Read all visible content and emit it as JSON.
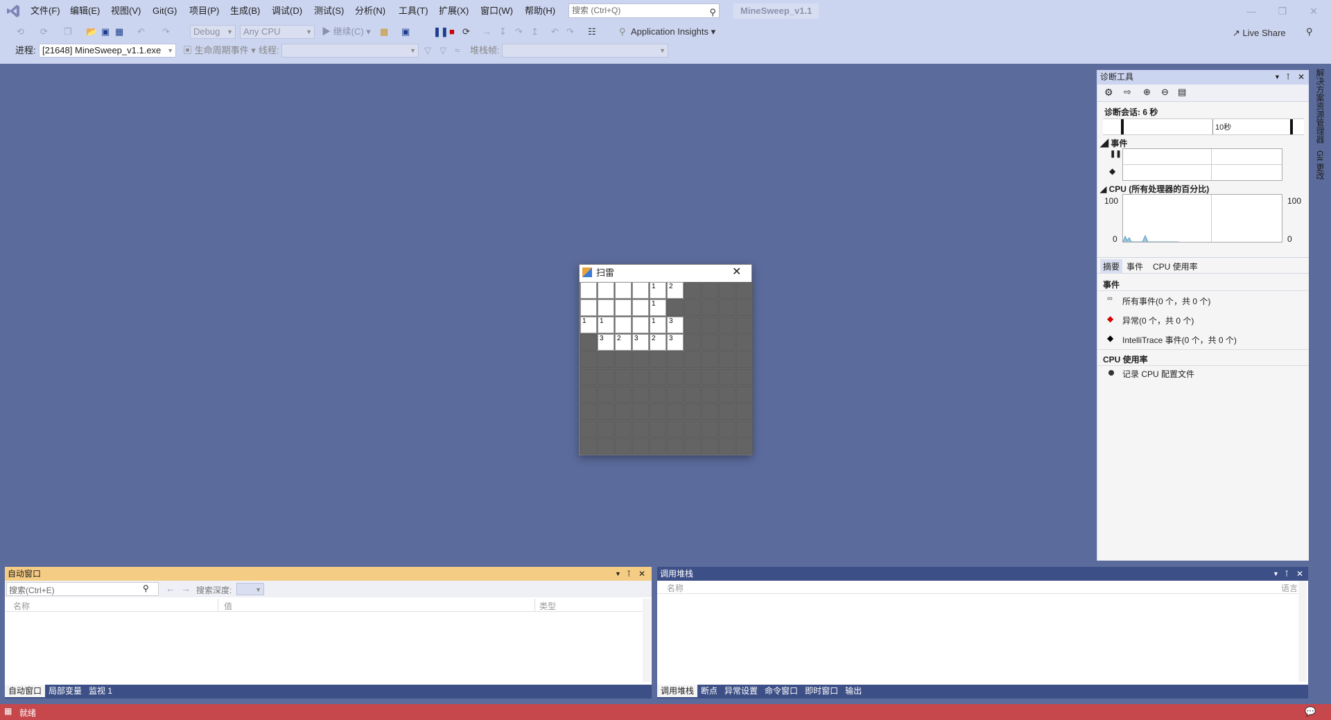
{
  "menu": [
    "文件(F)",
    "编辑(E)",
    "视图(V)",
    "Git(G)",
    "项目(P)",
    "生成(B)",
    "调试(D)",
    "测试(S)",
    "分析(N)",
    "工具(T)",
    "扩展(X)",
    "窗口(W)",
    "帮助(H)"
  ],
  "search": {
    "placeholder": "搜索 (Ctrl+Q)"
  },
  "solution_title": "MineSweep_v1.1",
  "toolbar": {
    "config": "Debug",
    "platform": "Any CPU",
    "continue_label": "继续(C)",
    "app_insights": "Application Insights",
    "live_share": "Live Share"
  },
  "debug_bar": {
    "process_label": "进程:",
    "process_value": "[21648] MineSweep_v1.1.exe",
    "lifecycle_label": "生命周期事件",
    "thread_label": "线程:",
    "stackframe_label": "堆栈帧:"
  },
  "minesweeper": {
    "title": "扫雷",
    "grid": [
      [
        "o",
        "o",
        "o",
        "o",
        "1",
        "2",
        "c",
        "c",
        "c",
        "c"
      ],
      [
        "o",
        "o",
        "o",
        "o",
        "1",
        "c",
        "c",
        "c",
        "c",
        "c"
      ],
      [
        "1",
        "1",
        "o",
        "o",
        "1",
        "3",
        "c",
        "c",
        "c",
        "c"
      ],
      [
        "c",
        "3",
        "2",
        "3",
        "2",
        "3",
        "c",
        "c",
        "c",
        "c"
      ],
      [
        "c",
        "c",
        "c",
        "c",
        "c",
        "c",
        "c",
        "c",
        "c",
        "c"
      ],
      [
        "c",
        "c",
        "c",
        "c",
        "c",
        "c",
        "c",
        "c",
        "c",
        "c"
      ],
      [
        "c",
        "c",
        "c",
        "c",
        "c",
        "c",
        "c",
        "c",
        "c",
        "c"
      ],
      [
        "c",
        "c",
        "c",
        "c",
        "c",
        "c",
        "c",
        "c",
        "c",
        "c"
      ],
      [
        "c",
        "c",
        "c",
        "c",
        "c",
        "c",
        "c",
        "c",
        "c",
        "c"
      ],
      [
        "c",
        "c",
        "c",
        "c",
        "c",
        "c",
        "c",
        "c",
        "c",
        "c"
      ]
    ]
  },
  "diag": {
    "title": "诊断工具",
    "session": "诊断会话: 6 秒",
    "timeline_label": "10秒",
    "events_section": "事件",
    "cpu_section": "CPU (所有处理器的百分比)",
    "cpu_max": "100",
    "cpu_min": "0",
    "tabs": [
      "摘要",
      "事件",
      "CPU 使用率"
    ],
    "events_heading": "事件",
    "event_items": [
      "所有事件(0 个，共 0 个)",
      "异常(0 个，共 0 个)",
      "IntelliTrace 事件(0 个，共 0 个)"
    ],
    "cpu_heading": "CPU 使用率",
    "cpu_item": "记录 CPU 配置文件"
  },
  "side_tabs": [
    "解决方案资源管理器",
    "Git 更改"
  ],
  "autos": {
    "title": "自动窗口",
    "search_placeholder": "搜索(Ctrl+E)",
    "depth_label": "搜索深度:",
    "columns": [
      "名称",
      "值",
      "类型"
    ],
    "tabs": [
      "自动窗口",
      "局部变量",
      "监视 1"
    ]
  },
  "callstack": {
    "title": "调用堆栈",
    "columns": [
      "名称",
      "语言"
    ],
    "tabs": [
      "调用堆栈",
      "断点",
      "异常设置",
      "命令窗口",
      "即时窗口",
      "输出"
    ]
  },
  "status": {
    "text": "就绪"
  },
  "colors": {
    "accent_status": "#c6474c",
    "autos_header": "#f5cc84",
    "callstack_header": "#3c4f86",
    "chrome": "#ccd5f0",
    "background": "#5b6b9c"
  }
}
